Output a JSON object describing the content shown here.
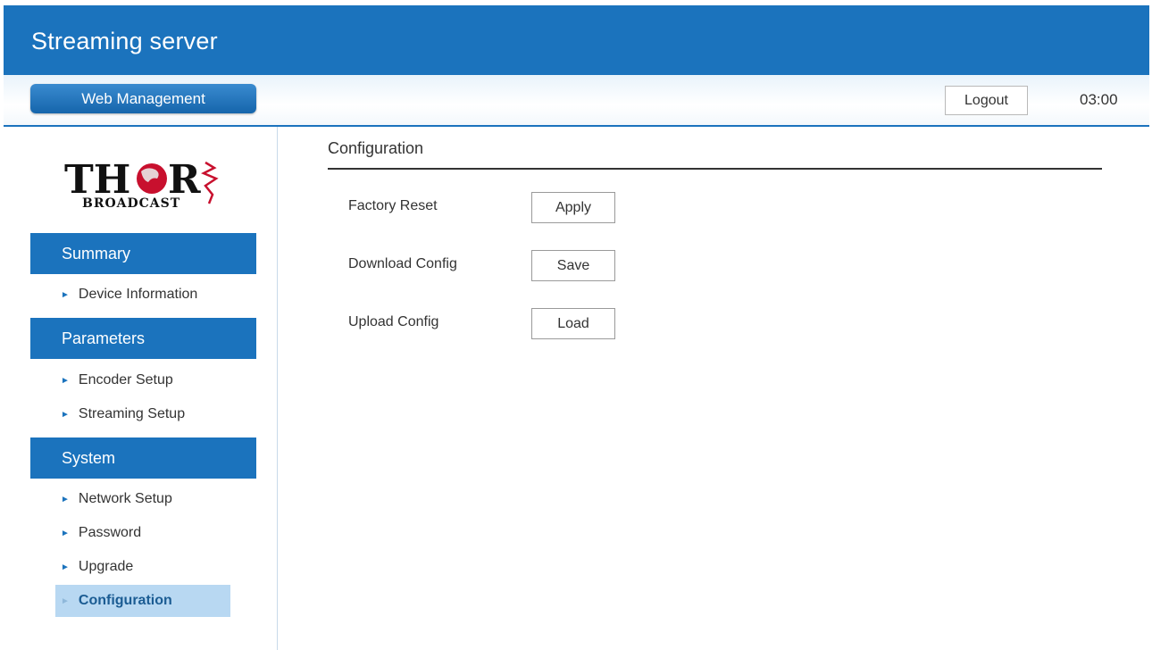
{
  "header": {
    "title": "Streaming server"
  },
  "subbar": {
    "web_management_label": "Web Management",
    "logout_label": "Logout",
    "clock": "03:00"
  },
  "logo": {
    "brand_main": "THOR",
    "brand_sub": "BROADCAST"
  },
  "sidebar": {
    "sections": [
      {
        "label": "Summary",
        "items": [
          {
            "label": "Device Information"
          }
        ]
      },
      {
        "label": "Parameters",
        "items": [
          {
            "label": "Encoder Setup"
          },
          {
            "label": "Streaming Setup"
          }
        ]
      },
      {
        "label": "System",
        "items": [
          {
            "label": "Network Setup"
          },
          {
            "label": "Password"
          },
          {
            "label": "Upgrade"
          },
          {
            "label": "Configuration",
            "active": true
          }
        ]
      }
    ]
  },
  "main": {
    "title": "Configuration",
    "rows": [
      {
        "label": "Factory Reset",
        "button": "Apply"
      },
      {
        "label": "Download Config",
        "button": "Save"
      },
      {
        "label": "Upload Config",
        "button": "Load"
      }
    ]
  },
  "colors": {
    "primary": "#1b73bd",
    "active_item_bg": "#b8d8f2"
  }
}
